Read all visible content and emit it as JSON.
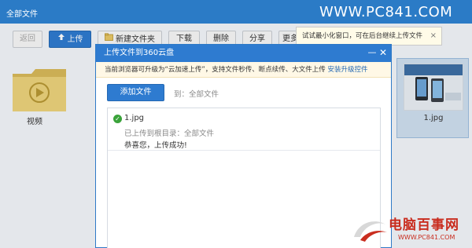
{
  "topbar": {
    "breadcrumb": "全部文件",
    "site_watermark": "WWW.PC841.COM"
  },
  "toolbar": {
    "back": "返回",
    "upload": "上传",
    "new_folder": "新建文件夹",
    "download": "下载",
    "delete": "删除",
    "share": "分享",
    "more": "更多"
  },
  "files": [
    {
      "name": "视频",
      "type": "folder"
    },
    {
      "name": "1.jpg",
      "type": "image"
    }
  ],
  "tooltip": {
    "text": "试试最小化窗口，可在后台继续上传文件",
    "close": "×"
  },
  "dialog": {
    "title": "上传文件到360云盘",
    "minimize": "—",
    "close": "✕",
    "tip_text": "当前浏览器可升级为“云加速上传”，支持文件秒传、断点续传、大文件上传",
    "tip_link": "安装升级控件",
    "add_button": "添加文件",
    "to_label": "到：",
    "to_dest": "全部文件",
    "uploads": [
      {
        "name": "1.jpg",
        "dir_line": "已上传到根目录：全部文件",
        "status": "恭喜您，上传成功!"
      }
    ]
  },
  "watermark": {
    "brand": "电脑百事网",
    "url": "WWW.PC841.COM"
  },
  "colors": {
    "accent": "#2e7bd0",
    "success": "#3aa33a",
    "watermark_red": "#c92d1f"
  }
}
